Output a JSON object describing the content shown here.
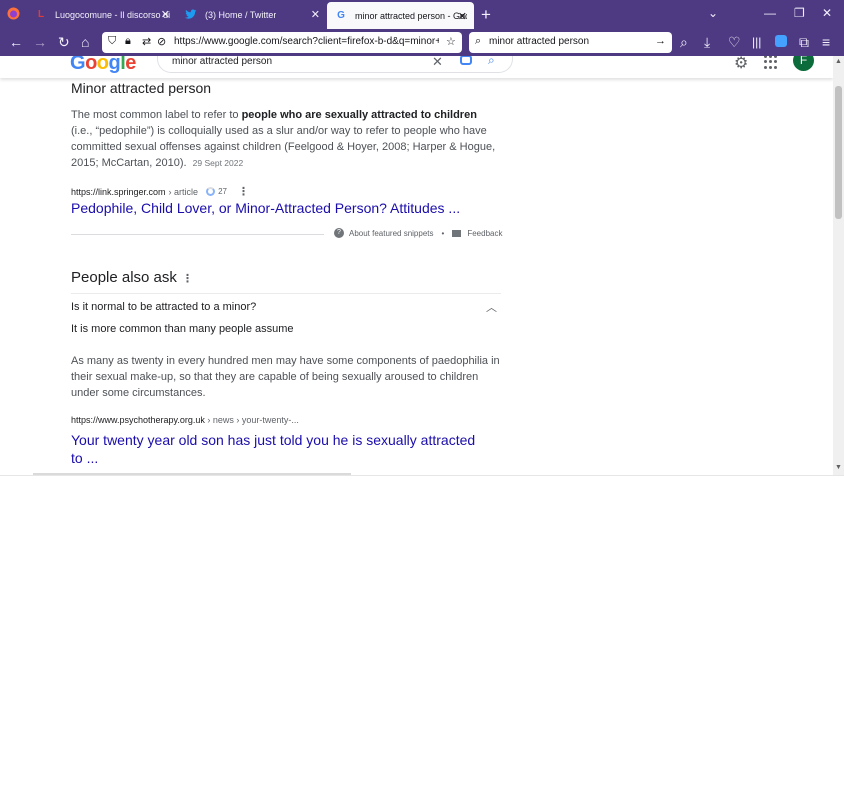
{
  "browser": {
    "tabs": [
      {
        "title": "Luogocomune - Il discorso di P...",
        "favicon": "L",
        "favicon_color": "#b71c1c",
        "active": false
      },
      {
        "title": "(3) Home / Twitter",
        "favicon": "twitter-bird",
        "favicon_color": "#1d9bf0",
        "active": false
      },
      {
        "title": "minor attracted person - Googl",
        "favicon": "G",
        "favicon_color": "#4285f4",
        "active": true
      }
    ],
    "url": "https://www.google.com/search?client=firefox-b-d&q=minor+attr",
    "search_query": "minor attracted person",
    "chrome_color": "#4e3a83"
  },
  "google": {
    "logo": "Google",
    "query": "minor attracted person",
    "avatar_letter": "F",
    "avatar_color": "#0b6b3a"
  },
  "featured_snippet": {
    "title": "Minor attracted person",
    "body_pre": "The most common label to refer to ",
    "body_bold": "people who are sexually attracted to children",
    "body_post": " (i.e., “pedophile”) is colloquially used as a slur and/or way to refer to people who have committed sexual offenses against children (Feelgood & Hoyer, 2008; Harper & Hogue, 2015; McCartan, 2010).",
    "date": "29 Sept 2022",
    "source_domain": "https://link.springer.com",
    "source_path": "› article",
    "citations": "27",
    "link_title": "Pedophile, Child Lover, or Minor-Attracted Person? Attitudes ...",
    "about_label": "About featured snippets",
    "bullet": "•",
    "feedback_label": "Feedback"
  },
  "people_also_ask": {
    "heading": "People also ask",
    "question": "Is it normal to be attracted to a minor?",
    "short_answer": "It is more common than many people assume",
    "answer": "As many as twenty in every hundred men may have some components of paedophilia in their sexual make-up, so that they are capable of being sexually aroused to children under some circumstances.",
    "source_domain": "https://www.psychotherapy.org.uk",
    "source_path": " › news › your-twenty-...",
    "link_title": "Your twenty year old son has just told you he is sexually attracted to ..."
  },
  "colors": {
    "link": "#1a0dab",
    "text": "#202124",
    "muted": "#4d5156"
  }
}
